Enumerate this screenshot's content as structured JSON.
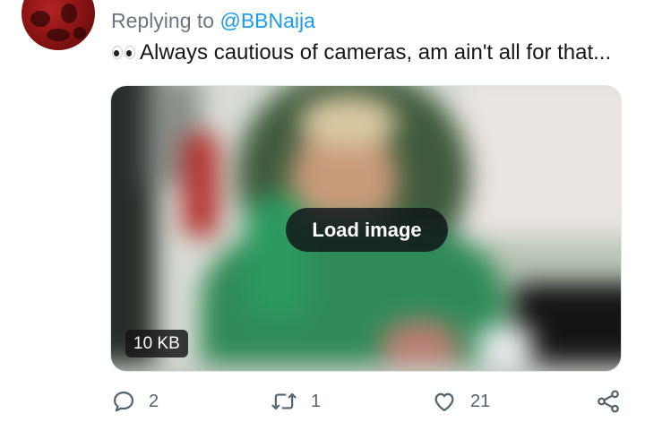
{
  "reply": {
    "prefix": "Replying to",
    "handle": "@BBNaija"
  },
  "tweet": {
    "emoji": "eyes-emoji",
    "text": "Always cautious of cameras, am ain't all for that..."
  },
  "media": {
    "load_label": "Load image",
    "size_label": "10 KB"
  },
  "actions": {
    "reply_count": "2",
    "retweet_count": "1",
    "like_count": "21"
  },
  "icons": [
    "reply-icon",
    "retweet-icon",
    "like-icon",
    "share-icon"
  ],
  "colors": {
    "link": "#1d9bf0",
    "muted": "#536471",
    "avatar": "#9b1b1b"
  }
}
